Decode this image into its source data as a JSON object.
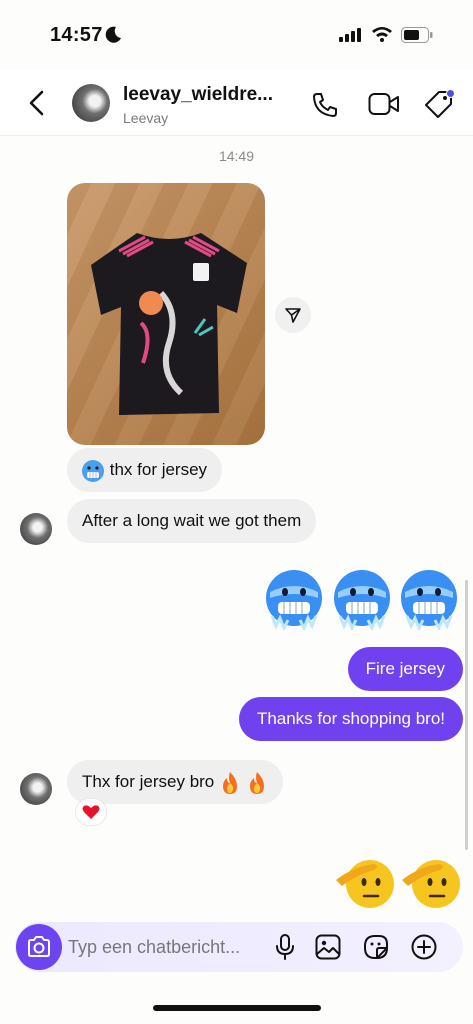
{
  "status_bar": {
    "time": "14:57"
  },
  "header": {
    "username": "leevay_wieldre...",
    "display_name": "Leevay"
  },
  "messages": {
    "timestamp": "14:49",
    "photo_reply": "thx for jersey",
    "incoming_1": "After a long wait we got them",
    "outgoing_1": "Fire jersey",
    "outgoing_2": "Thanks for shopping bro!",
    "incoming_2": "Thx for jersey bro",
    "reaction": "heart"
  },
  "composer": {
    "placeholder": "Typ een chatbericht..."
  },
  "colors": {
    "accent": "#7041ee",
    "bubble_in": "#efefef"
  }
}
